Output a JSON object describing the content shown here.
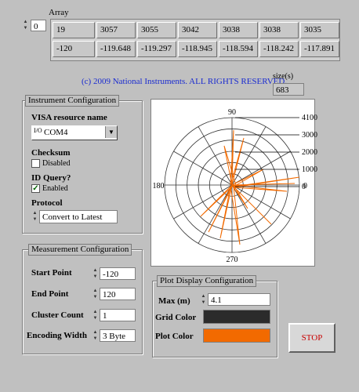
{
  "array": {
    "label": "Array",
    "index": "0",
    "row1": [
      "19",
      "3057",
      "3055",
      "3042",
      "3038",
      "3038",
      "3035"
    ],
    "row2": [
      "-120",
      "-119.648",
      "-119.297",
      "-118.945",
      "-118.594",
      "-118.242",
      "-117.891"
    ]
  },
  "copyright": "(c) 2009 National Instruments.  ALL RIGHTS RESERVED.",
  "size": {
    "label": "size(s)",
    "value": "683"
  },
  "instrument": {
    "title": "Instrument Configuration",
    "visa_label": "VISA resource name",
    "visa_value": "COM4",
    "checksum_label": "Checksum",
    "checksum_state": "Disabled",
    "idquery_label": "ID Query?",
    "idquery_state": "Enabled",
    "protocol_label": "Protocol",
    "protocol_value": "Convert to Latest"
  },
  "measurement": {
    "title": "Measurement Configuration",
    "start_label": "Start Point",
    "start_value": "-120",
    "end_label": "End Point",
    "end_value": "120",
    "cluster_label": "Cluster Count",
    "cluster_value": "1",
    "encoding_label": "Encoding Width",
    "encoding_value": "3 Byte"
  },
  "plot_config": {
    "title": "Plot Display Configuration",
    "max_label": "Max (m)",
    "max_value": "4.1",
    "grid_label": "Grid Color",
    "grid_color": "#2b2b2b",
    "plot_label": "Plot Color",
    "plot_color": "#f26a00"
  },
  "stop_label": "STOP",
  "polar": {
    "angle_labels": {
      "top": "90",
      "left": "180",
      "bottom": "270",
      "right": "0"
    },
    "radius_labels": [
      "4100",
      "3000",
      "2000",
      "1000",
      "0"
    ]
  }
}
